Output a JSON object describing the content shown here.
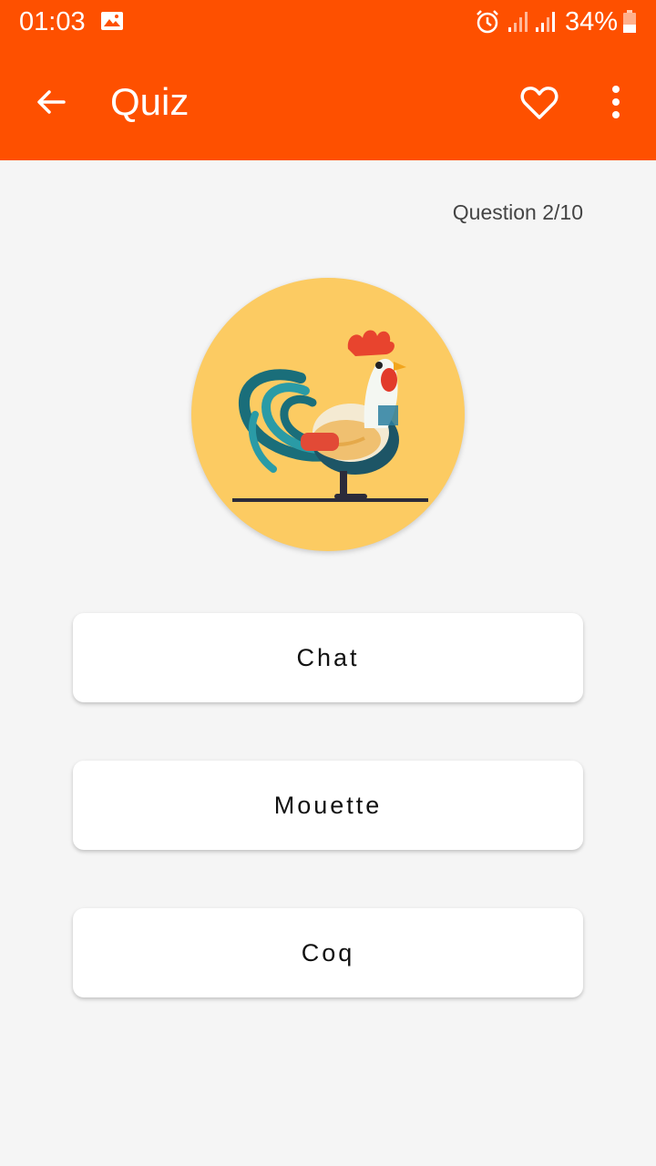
{
  "status_bar": {
    "time": "01:03",
    "battery": "34%"
  },
  "header": {
    "title": "Quiz"
  },
  "quiz": {
    "counter": "Question 2/10"
  },
  "answers": [
    {
      "label": "Chat"
    },
    {
      "label": "Mouette"
    },
    {
      "label": "Coq"
    }
  ],
  "colors": {
    "app_bar": "#fe5000",
    "background": "#f5f5f5",
    "image_circle": "#fccb62",
    "card": "#ffffff"
  },
  "icons": [
    "gallery-icon",
    "alarm-icon",
    "signal-icon",
    "battery-icon",
    "back-arrow-icon",
    "heart-icon",
    "more-vert-icon",
    "rooster-illustration"
  ]
}
